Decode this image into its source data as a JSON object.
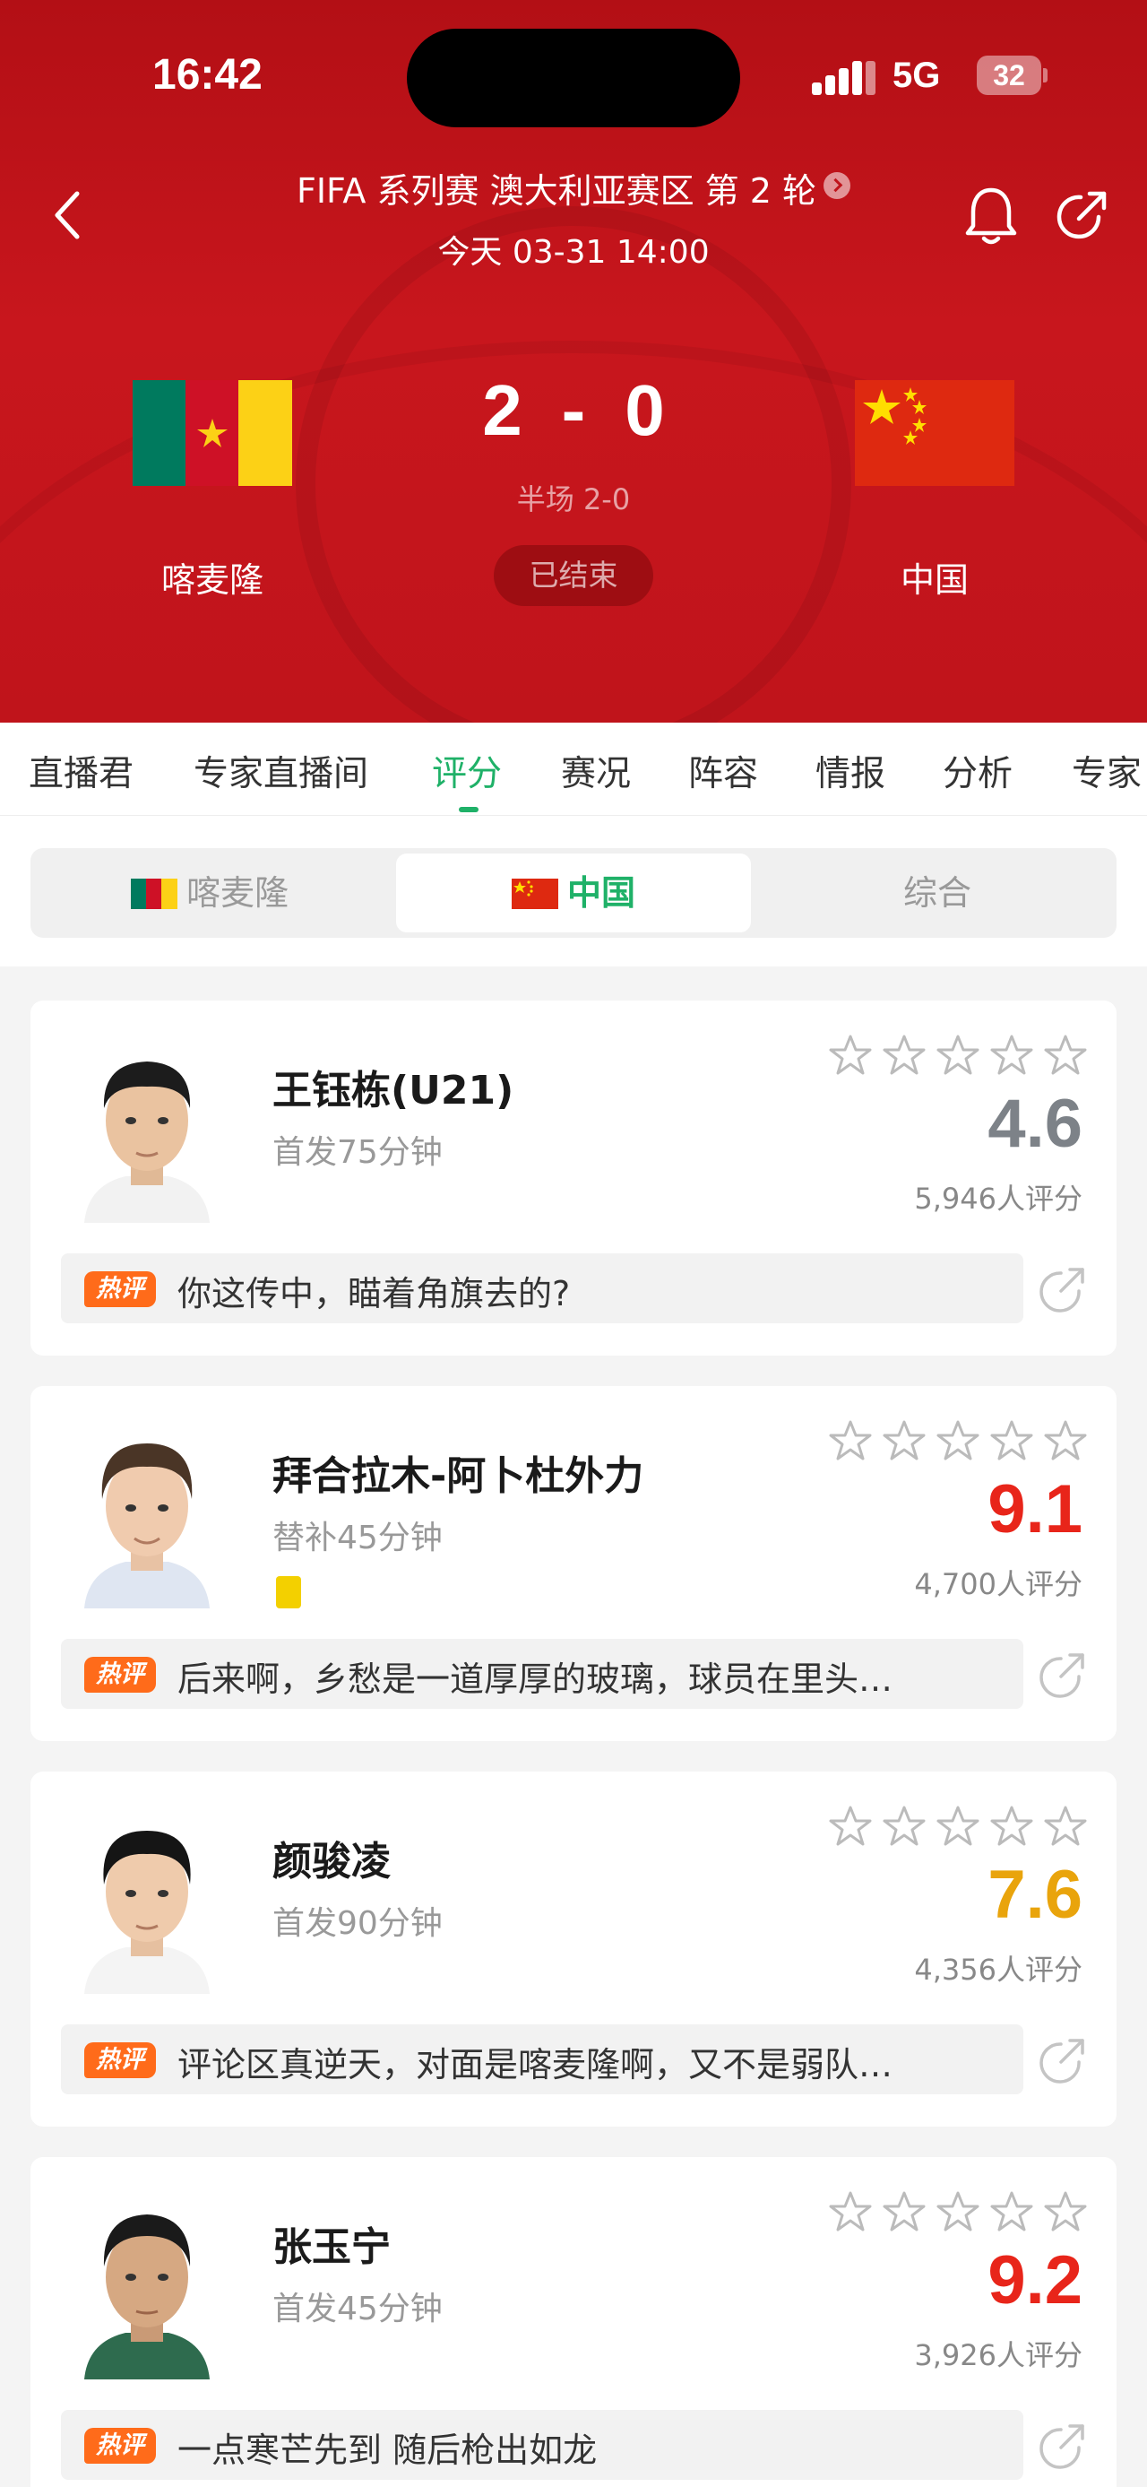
{
  "status_bar": {
    "time": "16:42",
    "network": "5G",
    "battery": "32"
  },
  "match": {
    "competition": "FIFA 系列赛 澳大利亚赛区 第 2 轮",
    "datetime": "今天 03-31 14:00",
    "home_team": "喀麦隆",
    "away_team": "中国",
    "home_score": "2",
    "separator": "-",
    "away_score": "0",
    "halftime": "半场 2-0",
    "status": "已结束"
  },
  "tabs": [
    {
      "label": "直播君"
    },
    {
      "label": "专家直播间"
    },
    {
      "label": "评分",
      "active": true
    },
    {
      "label": "赛况"
    },
    {
      "label": "阵容"
    },
    {
      "label": "情报"
    },
    {
      "label": "分析"
    },
    {
      "label": "专家"
    }
  ],
  "team_switch": [
    {
      "label": "喀麦隆",
      "flag": "cameroon"
    },
    {
      "label": "中国",
      "flag": "china",
      "active": true
    },
    {
      "label": "综合"
    }
  ],
  "hot_badge": "热评",
  "colors": {
    "accent": "#1fb168",
    "header_red": "#c0141b",
    "rating_gray": "#7d8288",
    "rating_red": "#e8251a",
    "rating_yellow": "#e9a40c",
    "hot_orange": "#ff6b1a"
  },
  "players": [
    {
      "name": "王钰栋(U21)",
      "sub": "首发75分钟",
      "rating": "4.6",
      "rating_color": "gray",
      "votes": "5,946人评分",
      "comment": "你这传中，瞄着角旗去的?",
      "yellow_card": false,
      "stars": 5
    },
    {
      "name": "拜合拉木-阿卜杜外力",
      "sub": "替补45分钟",
      "rating": "9.1",
      "rating_color": "red",
      "votes": "4,700人评分",
      "comment": "后来啊，乡愁是一道厚厚的玻璃，球员在里头…",
      "yellow_card": true,
      "stars": 5
    },
    {
      "name": "颜骏凌",
      "sub": "首发90分钟",
      "rating": "7.6",
      "rating_color": "yellow",
      "votes": "4,356人评分",
      "comment": "评论区真逆天，对面是喀麦隆啊，又不是弱队…",
      "yellow_card": false,
      "stars": 5
    },
    {
      "name": "张玉宁",
      "sub": "首发45分钟",
      "rating": "9.2",
      "rating_color": "red",
      "votes": "3,926人评分",
      "comment": "一点寒芒先到 随后枪出如龙",
      "yellow_card": false,
      "stars": 5
    }
  ]
}
